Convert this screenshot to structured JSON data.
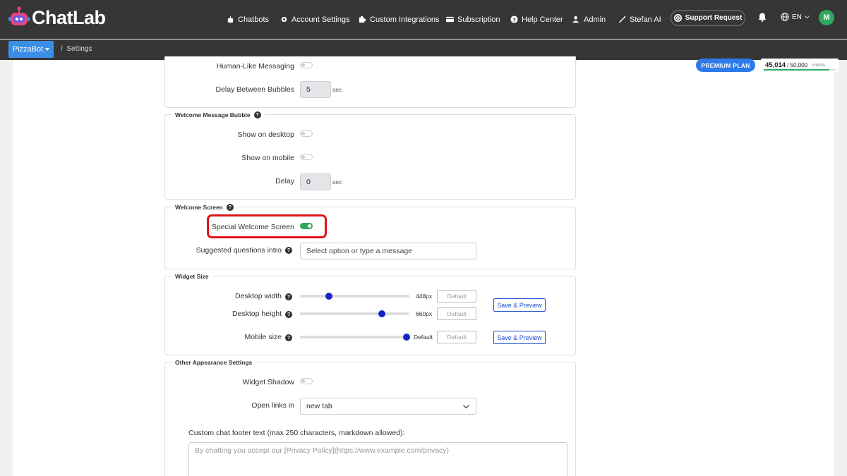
{
  "brand": {
    "name": "ChatLab",
    "accent": "#3b8ee5"
  },
  "nav": [
    {
      "icon": "chatbot-icon",
      "label": "Chatbots"
    },
    {
      "icon": "gear-icon",
      "label": "Account Settings"
    },
    {
      "icon": "puzzle-icon",
      "label": "Custom Integrations"
    },
    {
      "icon": "card-icon",
      "label": "Subscription"
    },
    {
      "icon": "question-icon",
      "label": "Help Center"
    },
    {
      "icon": "user-icon",
      "label": "Admin"
    },
    {
      "icon": "magic-icon",
      "label": "Stefan AI"
    }
  ],
  "support_label": "Support Request",
  "language": "EN",
  "avatar_initial": "M",
  "breadcrumb": {
    "bot": "PizzaBot",
    "separator": "/",
    "page": "Settings"
  },
  "plan": {
    "label": "PREMIUM PLAN",
    "credits_used": "45,014",
    "credits_total": "/ 50,000",
    "credits_label": "credits",
    "fraction": 0.9
  },
  "messaging": {
    "human_like_label": "Human-Like Messaging",
    "delay_label": "Delay Between Bubbles",
    "delay_value": "5",
    "unit": "sec"
  },
  "welcome_bubble": {
    "title": "Welcome Message Bubble",
    "desktop_label": "Show on desktop",
    "mobile_label": "Show on mobile",
    "delay_label": "Delay",
    "delay_value": "0",
    "unit": "sec"
  },
  "welcome_screen": {
    "title": "Welcome Screen",
    "special_label": "Special Welcome Screen",
    "special_on": true,
    "intro_label": "Suggested questions intro",
    "intro_placeholder": "Select option or type a message"
  },
  "widget_size": {
    "title": "Widget Size",
    "desktop_width_label": "Desktop width",
    "desktop_width_value": "448px",
    "desktop_height_label": "Desktop height",
    "desktop_height_value": "660px",
    "mobile_size_label": "Mobile size",
    "mobile_size_value": "Default",
    "default_placeholder": "Default",
    "save_label": "Save & Preview"
  },
  "other": {
    "title": "Other Appearance Settings",
    "shadow_label": "Widget Shadow",
    "links_label": "Open links in",
    "links_value": "new tab",
    "footer_label": "Custom chat footer text (max 250 characters, markdown allowed):",
    "footer_placeholder": "By chatting you accept our [Privacy Policy](https://www.example.com/privacy)"
  }
}
